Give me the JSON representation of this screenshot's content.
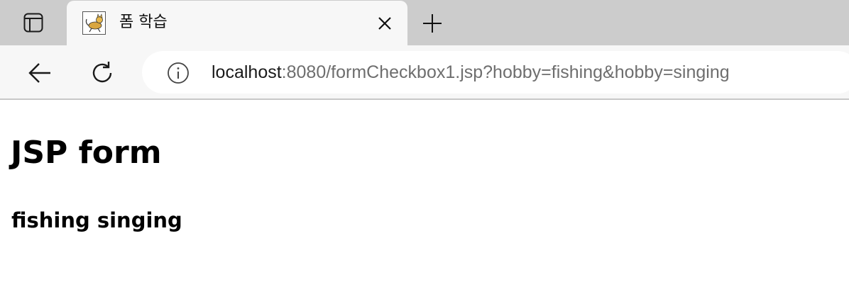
{
  "tab": {
    "title": "폼 학습",
    "favicon": "tomcat-icon"
  },
  "toolbar": {
    "url_host": "localhost",
    "url_rest": ":8080/formCheckbox1.jsp?hobby=fishing&hobby=singing"
  },
  "page": {
    "heading": "JSP form",
    "result": "fishing singing"
  },
  "colors": {
    "tabbar_bg": "#cccccc",
    "toolbar_bg": "#f7f7f7",
    "url_host": "#1a1a1a",
    "url_rest": "#6e6e6e"
  }
}
